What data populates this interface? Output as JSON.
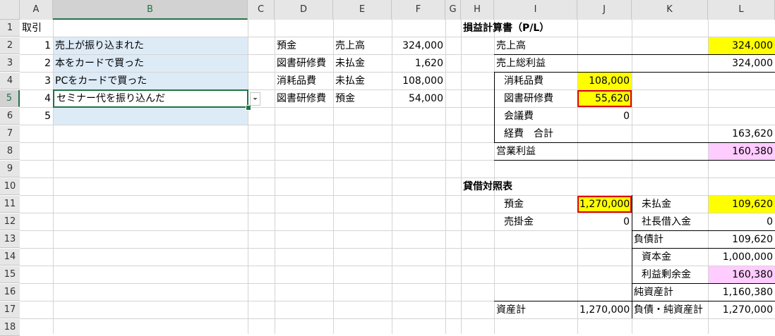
{
  "columns": [
    "A",
    "B",
    "C",
    "D",
    "E",
    "F",
    "G",
    "H",
    "I",
    "J",
    "K",
    "L"
  ],
  "rows": [
    "1",
    "2",
    "3",
    "4",
    "5",
    "6",
    "7",
    "8",
    "9",
    "10",
    "11",
    "12",
    "13",
    "14",
    "15",
    "16",
    "17",
    "18"
  ],
  "transactions": {
    "header": "取引",
    "numbers": [
      "1",
      "2",
      "3",
      "4",
      "5"
    ],
    "items": [
      "売上が振り込まれた",
      "本をカードで買った",
      "PCをカードで買った",
      "セミナー代を振り込んだ"
    ]
  },
  "journal": [
    {
      "debit": "預金",
      "credit": "売上高",
      "amount": "324,000"
    },
    {
      "debit": "図書研修費",
      "credit": "未払金",
      "amount": "1,620"
    },
    {
      "debit": "消耗品費",
      "credit": "未払金",
      "amount": "108,000"
    },
    {
      "debit": "図書研修費",
      "credit": "預金",
      "amount": "54,000"
    }
  ],
  "pl": {
    "title": "損益計算書（P/L）",
    "sales_label": "売上高",
    "sales_value": "324,000",
    "gross_label": "売上総利益",
    "gross_value": "324,000",
    "supplies_label": "消耗品費",
    "supplies_value": "108,000",
    "books_label": "図書研修費",
    "books_value": "55,620",
    "meeting_label": "会議費",
    "meeting_value": "0",
    "expense_total_label": "経費　合計",
    "expense_total_value": "163,620",
    "operating_label": "営業利益",
    "operating_value": "160,380"
  },
  "bs": {
    "title": "貸借対照表",
    "deposit_label": "預金",
    "deposit_value": "1,270,000",
    "receivable_label": "売掛金",
    "receivable_value": "0",
    "payable_label": "未払金",
    "payable_value": "109,620",
    "loan_label": "社長借入金",
    "loan_value": "0",
    "liab_total_label": "負債計",
    "liab_total_value": "109,620",
    "capital_label": "資本金",
    "capital_value": "1,000,000",
    "retained_label": "利益剰余金",
    "retained_value": "160,380",
    "netassets_label": "純資産計",
    "netassets_value": "1,160,380",
    "assets_total_label": "資産計",
    "assets_total_value": "1,270,000",
    "liab_net_total_label": "負債・純資産計",
    "liab_net_total_value": "1,270,000"
  },
  "colors": {
    "selection": "#217346",
    "highlight_yellow": "#ffff00",
    "highlight_pink": "#ffccff",
    "range_blue": "#ddebf7",
    "red_border": "#e00000"
  }
}
